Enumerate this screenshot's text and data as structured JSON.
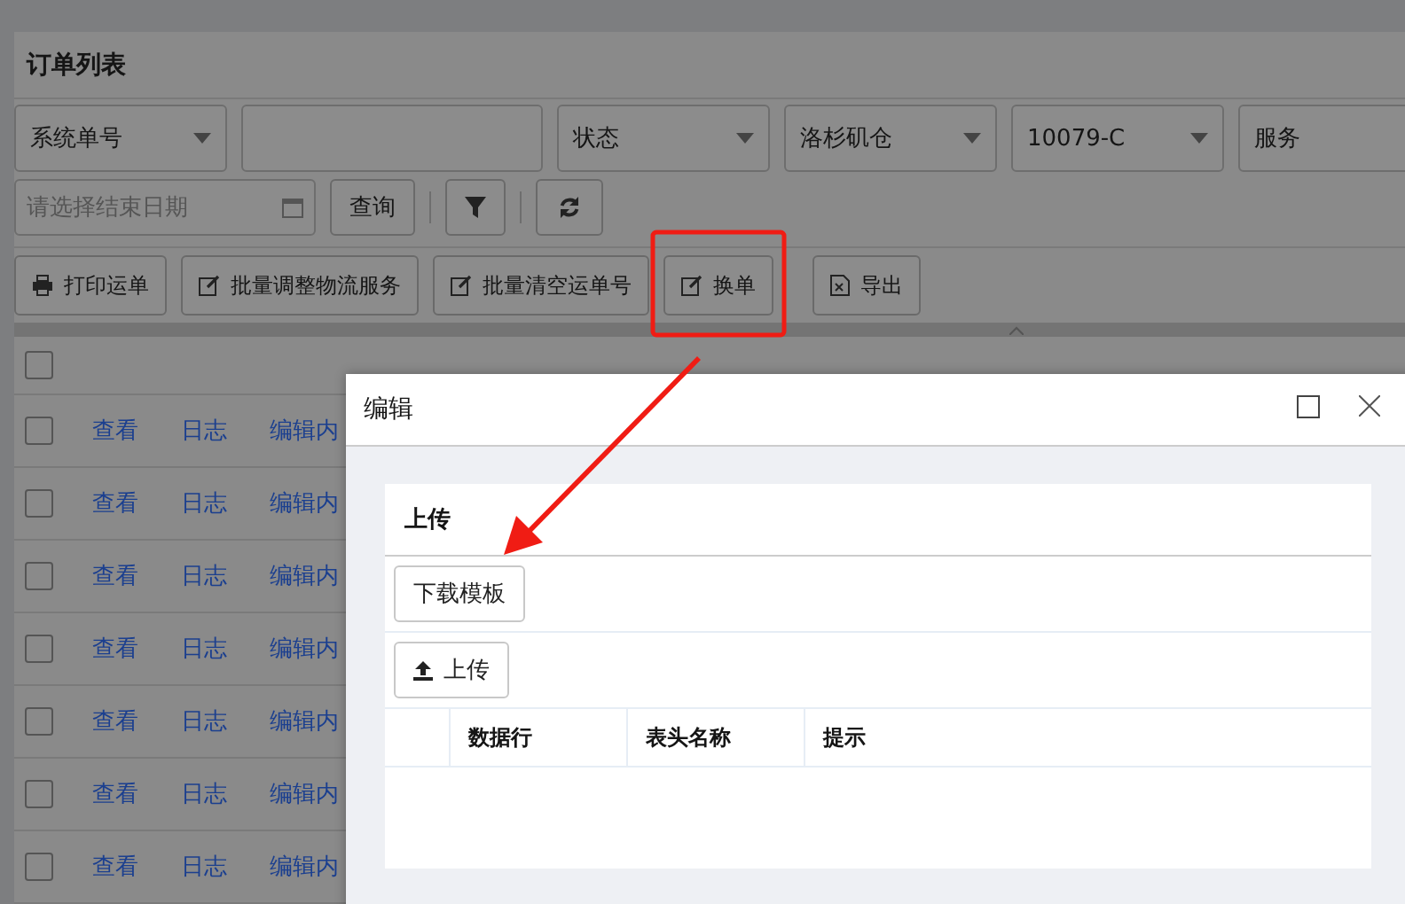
{
  "page": {
    "title": "订单列表"
  },
  "filters": [
    {
      "kind": "select",
      "value": "系统单号"
    },
    {
      "kind": "input"
    },
    {
      "kind": "select",
      "value": "状态"
    },
    {
      "kind": "select",
      "value": "洛杉矶仓"
    },
    {
      "kind": "select",
      "value": "10079-C"
    },
    {
      "kind": "select",
      "value": "服务"
    }
  ],
  "date_filter": {
    "placeholder": "请选择结束日期"
  },
  "query_button": "查询",
  "actions": [
    {
      "kind": "print",
      "label": "打印运单"
    },
    {
      "kind": "edit",
      "label": "批量调整物流服务"
    },
    {
      "kind": "edit",
      "label": "批量清空运单号"
    },
    {
      "kind": "edit",
      "label": "换单"
    },
    {
      "kind": "export",
      "label": "导出"
    }
  ],
  "table": {
    "select_all": {
      "checked": false
    },
    "rows": [
      {
        "checked": false,
        "view": "查看",
        "log": "日志",
        "edit": "编辑内"
      },
      {
        "checked": false,
        "view": "查看",
        "log": "日志",
        "edit": "编辑内"
      },
      {
        "checked": false,
        "view": "查看",
        "log": "日志",
        "edit": "编辑内"
      },
      {
        "checked": false,
        "view": "查看",
        "log": "日志",
        "edit": "编辑内"
      },
      {
        "checked": false,
        "view": "查看",
        "log": "日志",
        "edit": "编辑内"
      },
      {
        "checked": false,
        "view": "查看",
        "log": "日志",
        "edit": "编辑内"
      },
      {
        "checked": false,
        "view": "查看",
        "log": "日志",
        "edit": "编辑内"
      }
    ]
  },
  "dialog": {
    "title": "编辑",
    "section": "上传",
    "download_button": "下载模板",
    "upload_button": "上传",
    "columns": [
      "数据行",
      "表头名称",
      "提示"
    ]
  }
}
